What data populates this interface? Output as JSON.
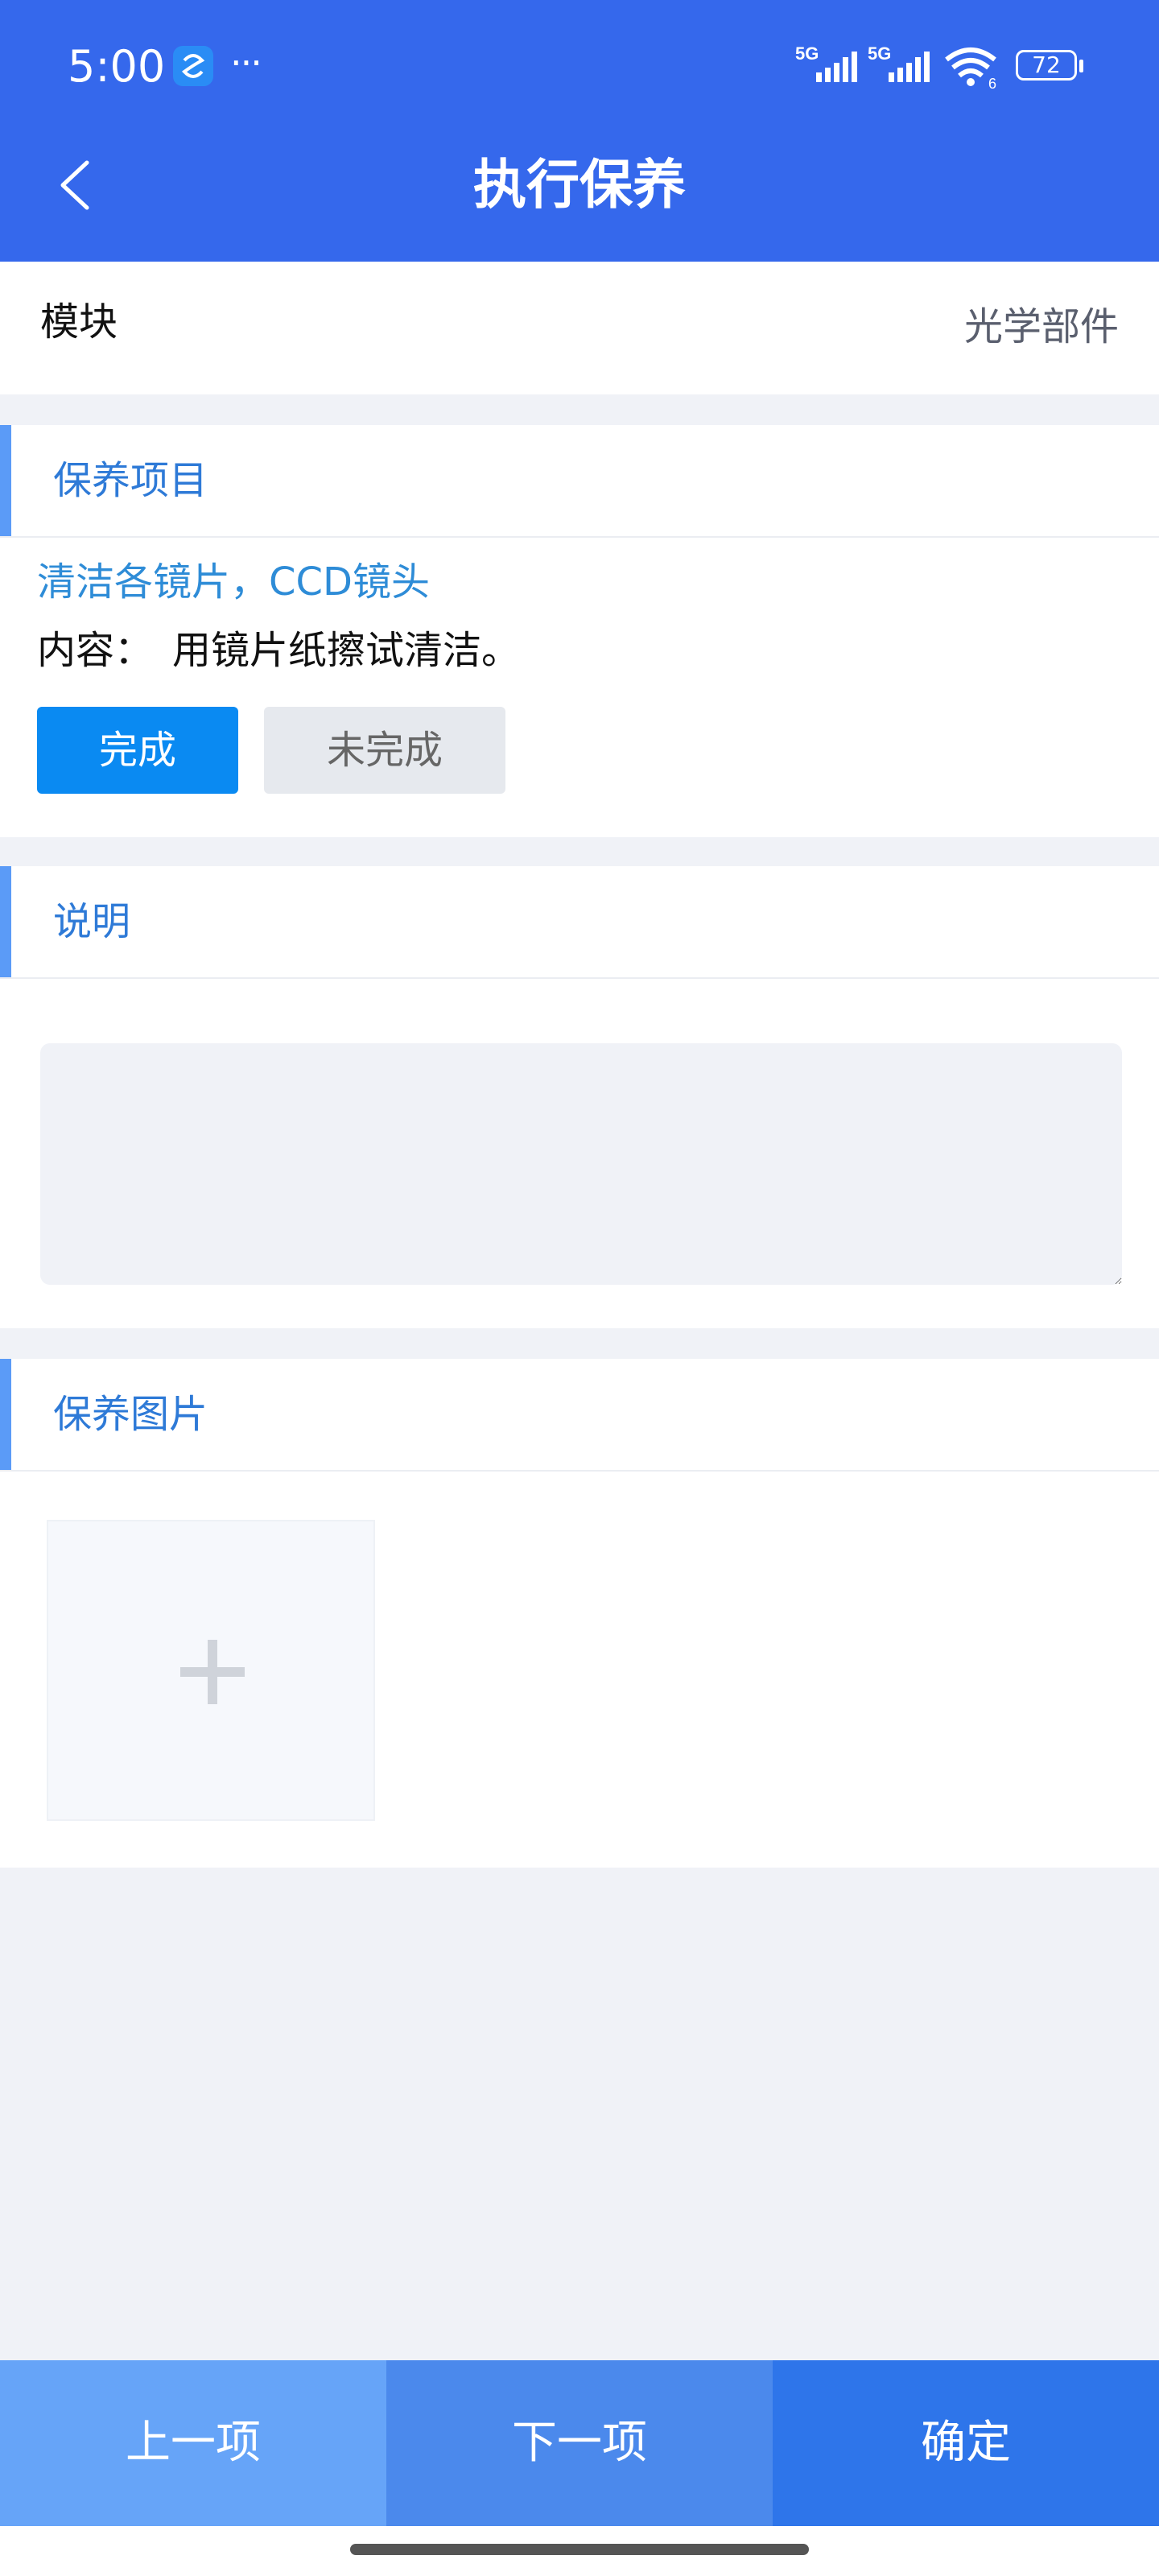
{
  "status_bar": {
    "time": "5:00",
    "more": "···",
    "signal_1_label": "5G",
    "signal_2_label": "5G",
    "wifi_label": "6",
    "battery": "72"
  },
  "header": {
    "title": "执行保养",
    "background_color": "#3568ec"
  },
  "module": {
    "label": "模块",
    "value": "光学部件"
  },
  "maintenance_item": {
    "section_title": "保养项目",
    "task_name": "清洁各镜片，CCD镜头",
    "content_label": "内容：",
    "content": "用镜片纸擦试清洁。",
    "done_label": "完成",
    "undone_label": "未完成",
    "done_color": "#0a8af2"
  },
  "description": {
    "section_title": "说明",
    "placeholder": ""
  },
  "photos": {
    "section_title": "保养图片",
    "add_icon": "plus-icon"
  },
  "bottom_bar": {
    "prev_label": "上一项",
    "next_label": "下一项",
    "confirm_label": "确定"
  }
}
